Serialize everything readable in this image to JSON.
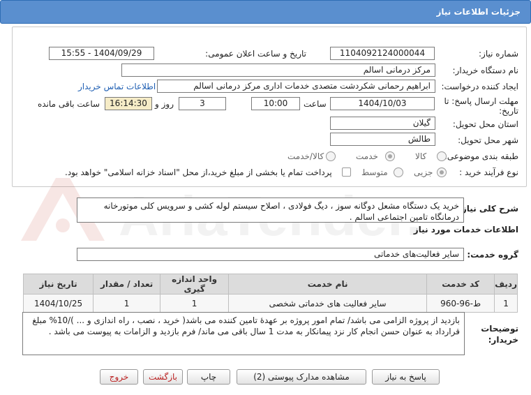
{
  "window": {
    "title": "جزئیات اطلاعات نیاز"
  },
  "fields": {
    "need_number_label": "شماره نیاز:",
    "need_number": "1104092124000044",
    "announce_label": "تاریخ و ساعت اعلان عمومی:",
    "announce_value": "1404/09/29 - 15:55",
    "buyer_org_label": "نام دستگاه خریدار:",
    "buyer_org": "مرکز درمانی اسالم",
    "creator_label": "ایجاد کننده درخواست:",
    "creator": "ابراهیم رحمانی شکردشت متصدی خدمات اداری مرکز درمانی اسالم",
    "contact_link": "اطلاعات تماس خریدار",
    "deadline_label_1": "مهلت ارسال پاسخ: تا",
    "deadline_label_2": "تاریخ:",
    "deadline_date": "1404/10/03",
    "time_label": "ساعت",
    "deadline_time": "10:00",
    "days_value": "3",
    "days_label": "روز و",
    "remaining_time": "16:14:30",
    "remaining_label": "ساعت باقی مانده",
    "province_label": "استان محل تحویل:",
    "province": "گیلان",
    "city_label": "شهر محل تحویل:",
    "city": "طالش",
    "category_label": "طبقه بندی موضوعی:",
    "category_options": [
      "کالا",
      "خدمت",
      "کالا/خدمت"
    ],
    "category_selected": "خدمت",
    "process_label": "نوع فرآیند خرید :",
    "process_options": [
      "جزیی",
      "متوسط"
    ],
    "process_selected": "جزیی",
    "treasury_note": "پرداخت تمام یا بخشی از مبلغ خرید،از محل \"اسناد خزانه اسلامی\" خواهد بود."
  },
  "summary": {
    "label": "شرح کلی نیاز:",
    "text": "خرید یک دستگاه مشعل دوگانه سوز ، دیگ فولادی ، اصلاح سیستم لوله کشی و سرویس کلی موتورخانه درمانگاه تامین اجتماعی اسالم ."
  },
  "services": {
    "section_title": "اطلاعات خدمات مورد نیاز",
    "group_label": "گروه خدمت:",
    "group_value": "سایر فعالیت‌های خدماتی",
    "columns": [
      "ردیف",
      "کد خدمت",
      "نام خدمت",
      "واحد اندازه گیری",
      "تعداد / مقدار",
      "تاریخ نیاز"
    ],
    "rows": [
      [
        "1",
        "ط-96-960",
        "سایر فعالیت های خدماتی شخصی",
        "1",
        "1",
        "1404/10/25"
      ]
    ]
  },
  "buyer_notes": {
    "label_1": "توضیحات",
    "label_2": "خریدار:",
    "text": "بازدید از پروژه الزامی می باشد/ تمام امور پروژه بر عهدۀ تامین کننده می باشد( خرید ، نصب ، راه اندازی و ... )/10% مبلغ قرارداد به عنوان حسن انجام کار نزد پیمانکار به مدت 1 سال باقی می ماند/ فرم بازدید و الزامات به پیوست می باشد ."
  },
  "buttons": {
    "reply": "پاسخ به نیاز",
    "attachments": "مشاهده مدارک پیوستی (2)",
    "print": "چاپ",
    "back": "بازگشت",
    "exit": "خروج"
  },
  "watermark": {
    "text": "AriaTender.neT"
  },
  "colors": {
    "title_bar": "#5a8fcf",
    "highlight": "#f6ecc7",
    "link": "#1f5fb3"
  }
}
